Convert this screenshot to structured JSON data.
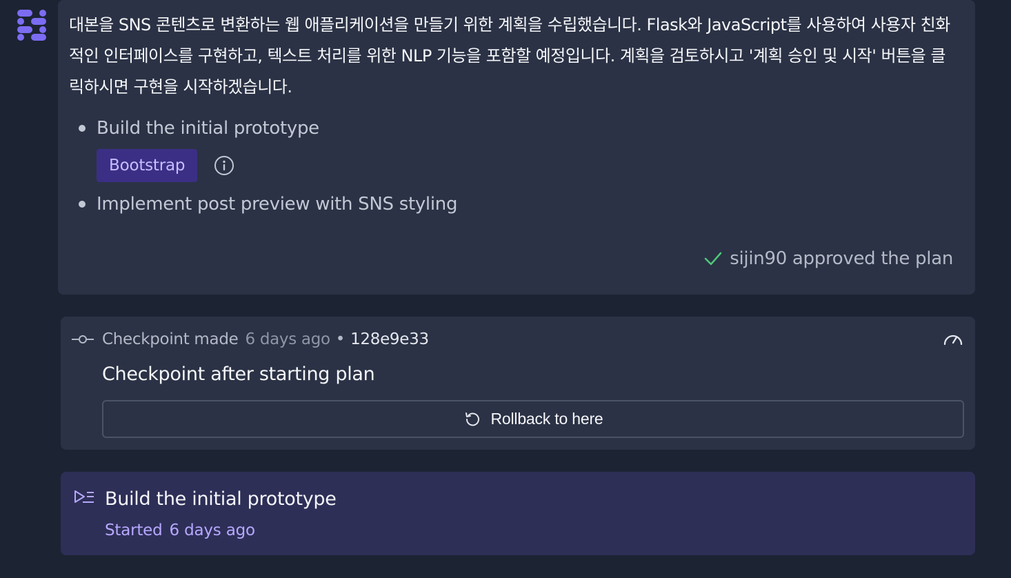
{
  "plan_message": {
    "text": "대본을 SNS 콘텐츠로 변환하는 웹 애플리케이션을 만들기 위한 계획을 수립했습니다. Flask와 JavaScript를 사용하여 사용자 친화적인 인터페이스를 구현하고, 텍스트 처리를 위한 NLP 기능을 포함할 예정입니다. 계획을 검토하시고 '계획 승인 및 시작' 버튼을 클릭하시면 구현을 시작하겠습니다.",
    "steps": [
      {
        "label": "Build the initial prototype",
        "tags": [
          "Bootstrap"
        ]
      },
      {
        "label": "Implement post preview with SNS styling",
        "tags": []
      }
    ],
    "approval_text": "sijin90 approved the plan"
  },
  "checkpoint": {
    "label": "Checkpoint made",
    "time": "6 days ago",
    "separator": "•",
    "hash": "128e9e33",
    "title": "Checkpoint after starting plan",
    "rollback_label": "Rollback to here"
  },
  "current_step": {
    "title": "Build the initial prototype",
    "status": "Started",
    "time": "6 days ago"
  },
  "colors": {
    "background": "#1c2333",
    "card": "#2b3245",
    "step_card": "#2e2f57",
    "tag_bg": "#3b2f85",
    "accent_purple": "#b6a8ff",
    "check_green": "#4ec97a",
    "logo": "#7c6cf2"
  },
  "icons": {
    "logo": "agent-logo",
    "info": "info-icon",
    "check": "check-icon",
    "commit": "commit-icon",
    "speed": "gauge-icon",
    "rollback": "rollback-icon",
    "step": "step-list-icon"
  }
}
